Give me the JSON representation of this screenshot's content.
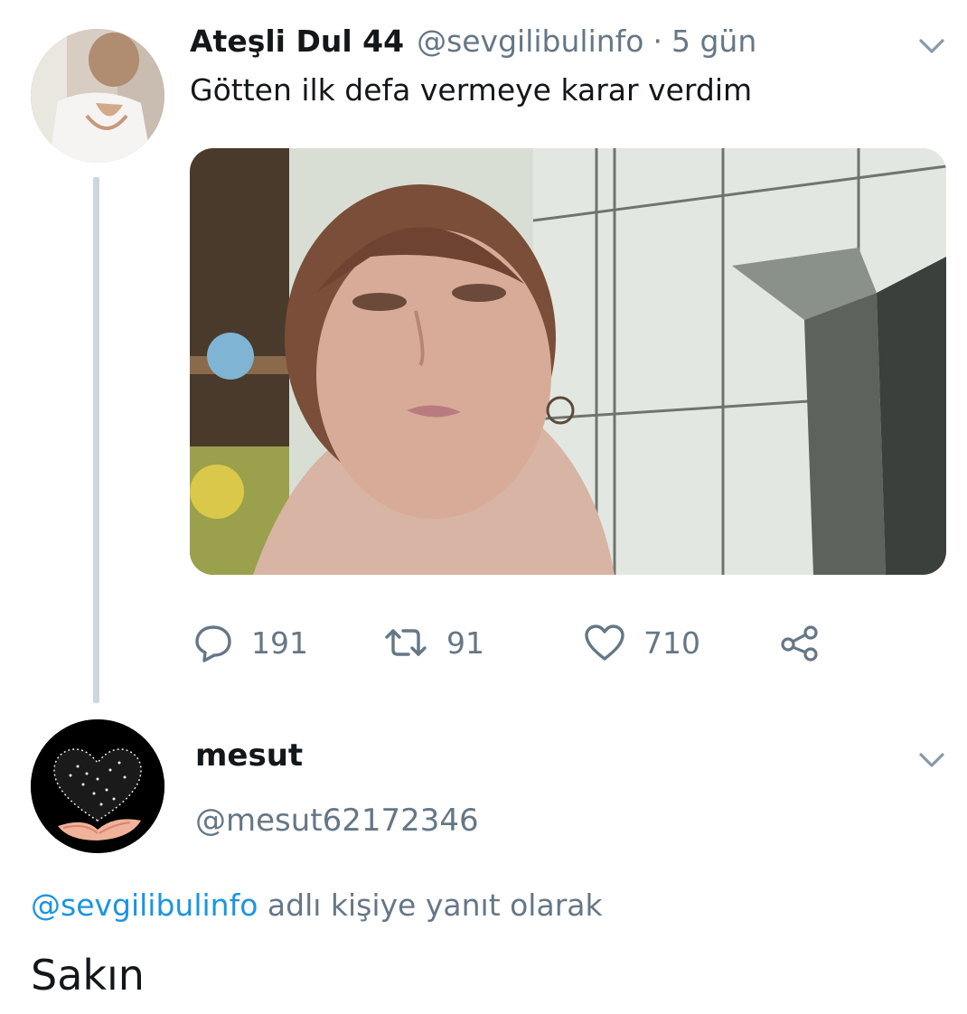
{
  "tweet": {
    "display_name": "Ateşli Dul 44",
    "handle": "@sevgilibulinfo",
    "separator": "·",
    "time": "5 gün",
    "text": "Götten ilk defa vermeye karar verdim",
    "actions": {
      "reply_icon": "speech-bubble-icon",
      "reply_count": "191",
      "retweet_icon": "retweet-icon",
      "retweet_count": "91",
      "like_icon": "heart-icon",
      "like_count": "710",
      "share_icon": "share-icon"
    },
    "menu_icon": "chevron-down-icon"
  },
  "reply": {
    "display_name": "mesut",
    "handle": "@mesut62172346",
    "replying_to_mention": "@sevgilibulinfo",
    "replying_to_suffix": " adlı kişiye yanıt olarak",
    "text": "Sakın",
    "menu_icon": "chevron-down-icon"
  },
  "colors": {
    "primary_text": "#14171a",
    "secondary_text": "#657786",
    "link": "#1b95e0",
    "thread_line": "#ccd6dd"
  }
}
